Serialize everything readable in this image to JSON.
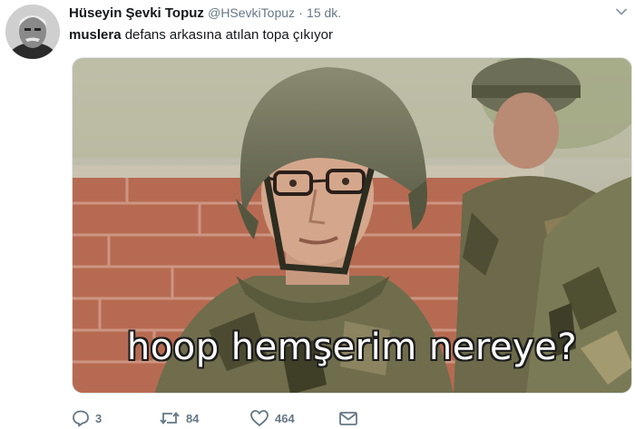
{
  "tweet": {
    "author_name": "Hüseyin Şevki Topuz",
    "handle": "@HSevkiTopuz",
    "separator": "·",
    "time": "15 dk.",
    "mention": "muslera",
    "text": " defans arkasına atılan topa çıkıyor"
  },
  "media": {
    "subtitle": "hoop hemşerim nereye?"
  },
  "actions": {
    "replies": "3",
    "retweets": "84",
    "likes": "464"
  },
  "icons": {
    "reply": "reply-icon",
    "retweet": "retweet-icon",
    "like": "heart-icon",
    "dm": "envelope-icon",
    "menu": "chevron-down-icon"
  },
  "colors": {
    "name": "#14171a",
    "muted": "#657786",
    "border": "#e1e8ed"
  }
}
